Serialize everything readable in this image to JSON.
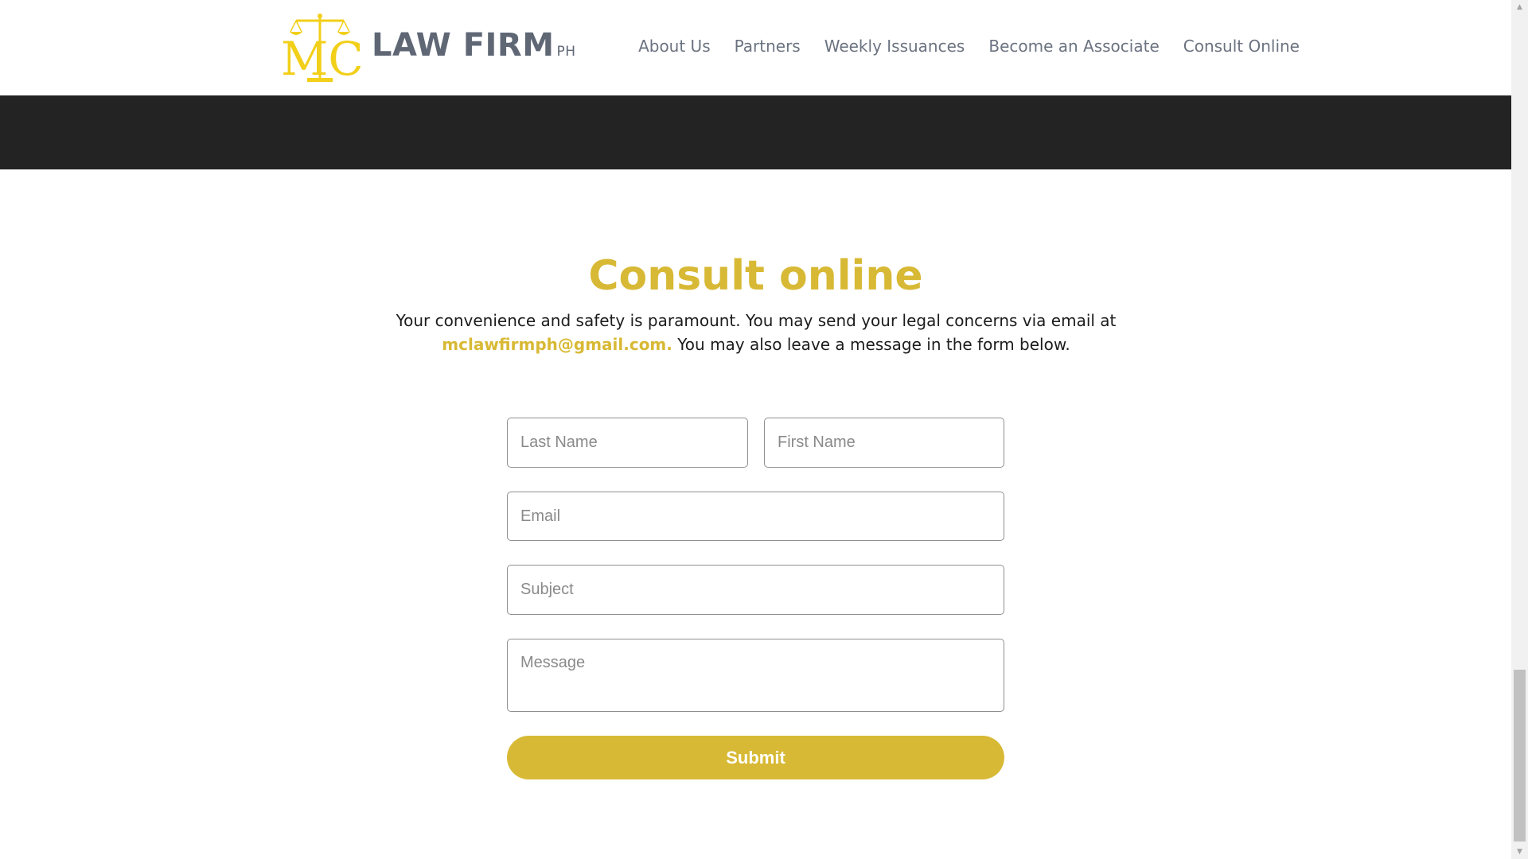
{
  "brand": {
    "logo_letters": "MC",
    "name": "LAW FIRM",
    "suffix": "PH",
    "color": "#d8b935"
  },
  "nav": {
    "items": [
      {
        "label": "About Us"
      },
      {
        "label": "Partners"
      },
      {
        "label": "Weekly Issuances"
      },
      {
        "label": "Become an Associate"
      },
      {
        "label": "Consult Online"
      }
    ]
  },
  "section": {
    "title": "Consult online",
    "intro_before": "Your convenience and safety is paramount. You may send your legal concerns via email at",
    "email": "mclawfirmph@gmail.com.",
    "intro_after": " You may also leave a message in the form below."
  },
  "form": {
    "last_name": {
      "placeholder": "Last Name",
      "value": ""
    },
    "first_name": {
      "placeholder": "First Name",
      "value": ""
    },
    "email": {
      "placeholder": "Email",
      "value": ""
    },
    "subject": {
      "placeholder": "Subject",
      "value": ""
    },
    "message": {
      "placeholder": "Message",
      "value": ""
    },
    "submit_label": "Submit"
  },
  "colors": {
    "accent": "#d8b935",
    "dark_band": "#232323",
    "nav_text": "#6b7380"
  },
  "scrollbar": {
    "up_icon": "▲",
    "down_icon": "▼"
  }
}
